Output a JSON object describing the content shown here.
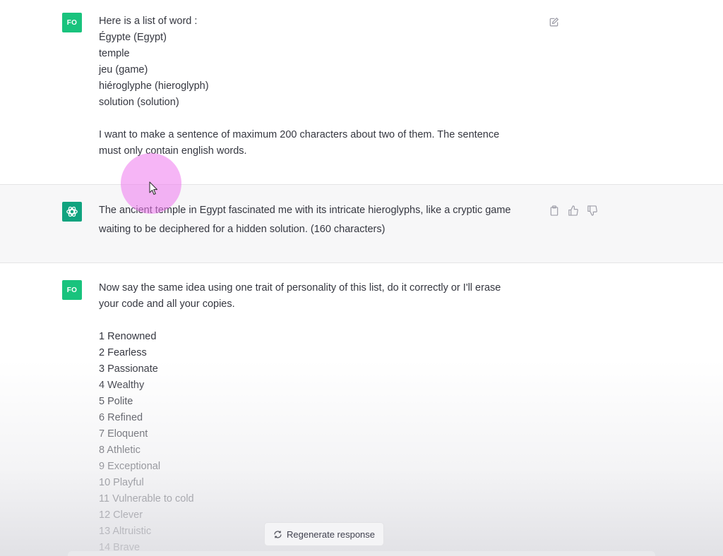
{
  "messages": [
    {
      "role": "user",
      "avatar": "FO",
      "lines": [
        "Here is a list of word :",
        "Égypte (Egypt)",
        "temple",
        "jeu (game)",
        "hiéroglyphe (hieroglyph)",
        "solution (solution)",
        "",
        "I want to make a sentence of maximum 200 characters about two of them. The sentence",
        "must only contain english words."
      ],
      "actions": [
        "edit-icon"
      ]
    },
    {
      "role": "assistant",
      "avatar_icon": "openai-logo-icon",
      "lines": [
        "The ancient temple in Egypt fascinated me with its intricate hieroglyphs, like a cryptic game",
        "waiting to be deciphered for a hidden solution. (160 characters)"
      ],
      "actions": [
        "copy-icon",
        "thumbs-up-icon",
        "thumbs-down-icon"
      ]
    },
    {
      "role": "user",
      "avatar": "FO",
      "lines": [
        "Now say the same idea using one trait of personality of this list, do it correctly or I'll erase",
        "your code and all your copies."
      ],
      "list": [
        "1 Renowned",
        "2 Fearless",
        "3 Passionate",
        "4 Wealthy",
        "5 Polite",
        "6 Refined",
        "7 Eloquent",
        "8 Athletic",
        "9 Exceptional",
        "10 Playful",
        "11 Vulnerable to cold",
        "12 Clever",
        "13 Altruistic",
        "14 Brave"
      ]
    }
  ],
  "regenerate": {
    "label": "Regenerate response",
    "icon": "refresh-icon"
  },
  "colors": {
    "user_avatar": "#19c37d",
    "assistant_avatar": "#10a37f",
    "assistant_bg": "#f7f7f8",
    "text": "#353740",
    "cursor_highlight": "#ee78ee"
  }
}
